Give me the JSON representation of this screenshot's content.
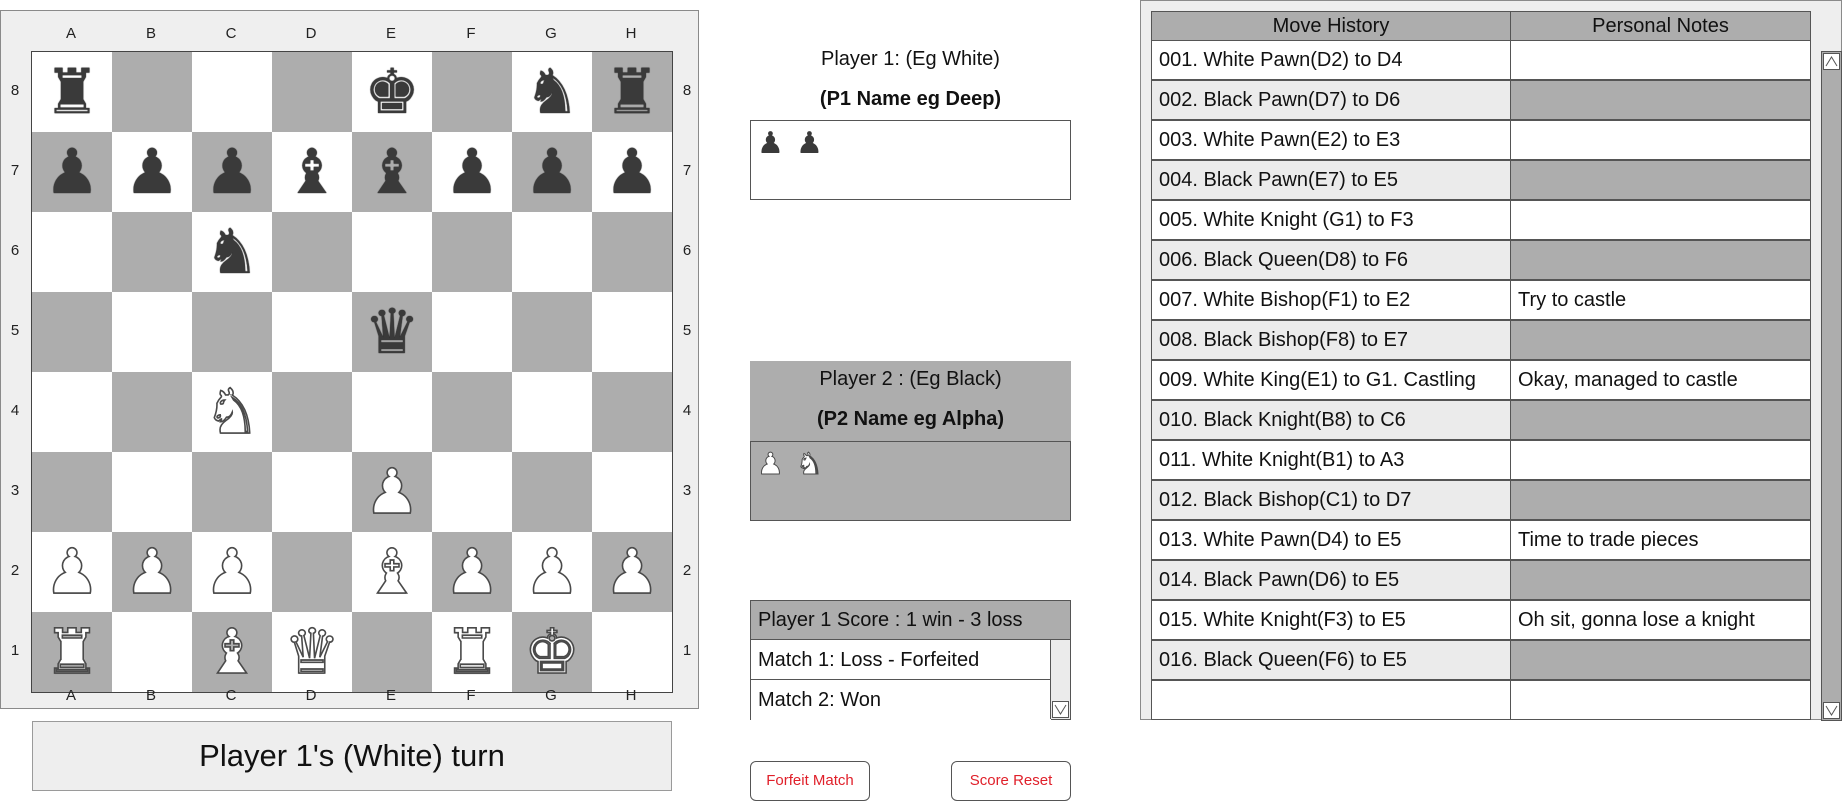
{
  "board": {
    "files": [
      "A",
      "B",
      "C",
      "D",
      "E",
      "F",
      "G",
      "H"
    ],
    "ranks": [
      "8",
      "7",
      "6",
      "5",
      "4",
      "3",
      "2",
      "1"
    ],
    "rows": [
      [
        "bR",
        "",
        "",
        "",
        "bK",
        "",
        "bN",
        "bR"
      ],
      [
        "bP",
        "bP",
        "bP",
        "bB",
        "bB",
        "bP",
        "bP",
        "bP"
      ],
      [
        "",
        "",
        "bN",
        "",
        "",
        "",
        "",
        ""
      ],
      [
        "",
        "",
        "",
        "",
        "bQ",
        "",
        "",
        ""
      ],
      [
        "",
        "",
        "wN",
        "",
        "",
        "",
        "",
        ""
      ],
      [
        "",
        "",
        "",
        "",
        "wP",
        "",
        "",
        ""
      ],
      [
        "wP",
        "wP",
        "wP",
        "",
        "wB",
        "wP",
        "wP",
        "wP"
      ],
      [
        "wR",
        "",
        "wB",
        "wQ",
        "",
        "wR",
        "wK",
        ""
      ]
    ]
  },
  "turn_text": "Player 1's (White) turn",
  "player1": {
    "label": "Player 1: (Eg White)",
    "name": "(P1 Name eg Deep)",
    "captured": [
      "bP",
      "bP"
    ]
  },
  "player2": {
    "label": "Player 2 : (Eg Black)",
    "name": "(P2 Name eg Alpha)",
    "captured": [
      "wP",
      "wN"
    ]
  },
  "score": {
    "header": "Player 1 Score : 1 win - 3 loss",
    "matches": [
      "Match 1: Loss - Forfeited",
      "Match 2: Won"
    ]
  },
  "buttons": {
    "forfeit": "Forfeit Match",
    "reset": "Score Reset"
  },
  "history": {
    "headers": [
      "Move History",
      "Personal Notes"
    ],
    "rows": [
      {
        "move": "001. White Pawn(D2) to D4",
        "note": ""
      },
      {
        "move": "002. Black Pawn(D7) to D6",
        "note": ""
      },
      {
        "move": "003. White Pawn(E2) to E3",
        "note": ""
      },
      {
        "move": "004. Black Pawn(E7) to E5",
        "note": ""
      },
      {
        "move": "005. White Knight (G1) to F3",
        "note": ""
      },
      {
        "move": "006. Black Queen(D8) to F6",
        "note": ""
      },
      {
        "move": "007. White Bishop(F1) to E2",
        "note": "Try to castle"
      },
      {
        "move": "008. Black Bishop(F8) to E7",
        "note": ""
      },
      {
        "move": "009. White King(E1) to G1. Castling",
        "note": "Okay, managed to castle"
      },
      {
        "move": "010. Black Knight(B8) to C6",
        "note": ""
      },
      {
        "move": "011. White Knight(B1) to A3",
        "note": ""
      },
      {
        "move": "012. Black Bishop(C1) to D7",
        "note": ""
      },
      {
        "move": "013. White Pawn(D4) to E5",
        "note": "Time to trade pieces"
      },
      {
        "move": "014. Black Pawn(D6) to E5",
        "note": ""
      },
      {
        "move": "015. White Knight(F3) to E5",
        "note": "Oh sit, gonna lose a knight"
      },
      {
        "move": "016. Black Queen(F6) to E5",
        "note": ""
      },
      {
        "move": "",
        "note": ""
      }
    ]
  },
  "colors": {
    "dark_square": "#adadad",
    "light_square": "#ffffff",
    "button_text": "#e0202a"
  }
}
